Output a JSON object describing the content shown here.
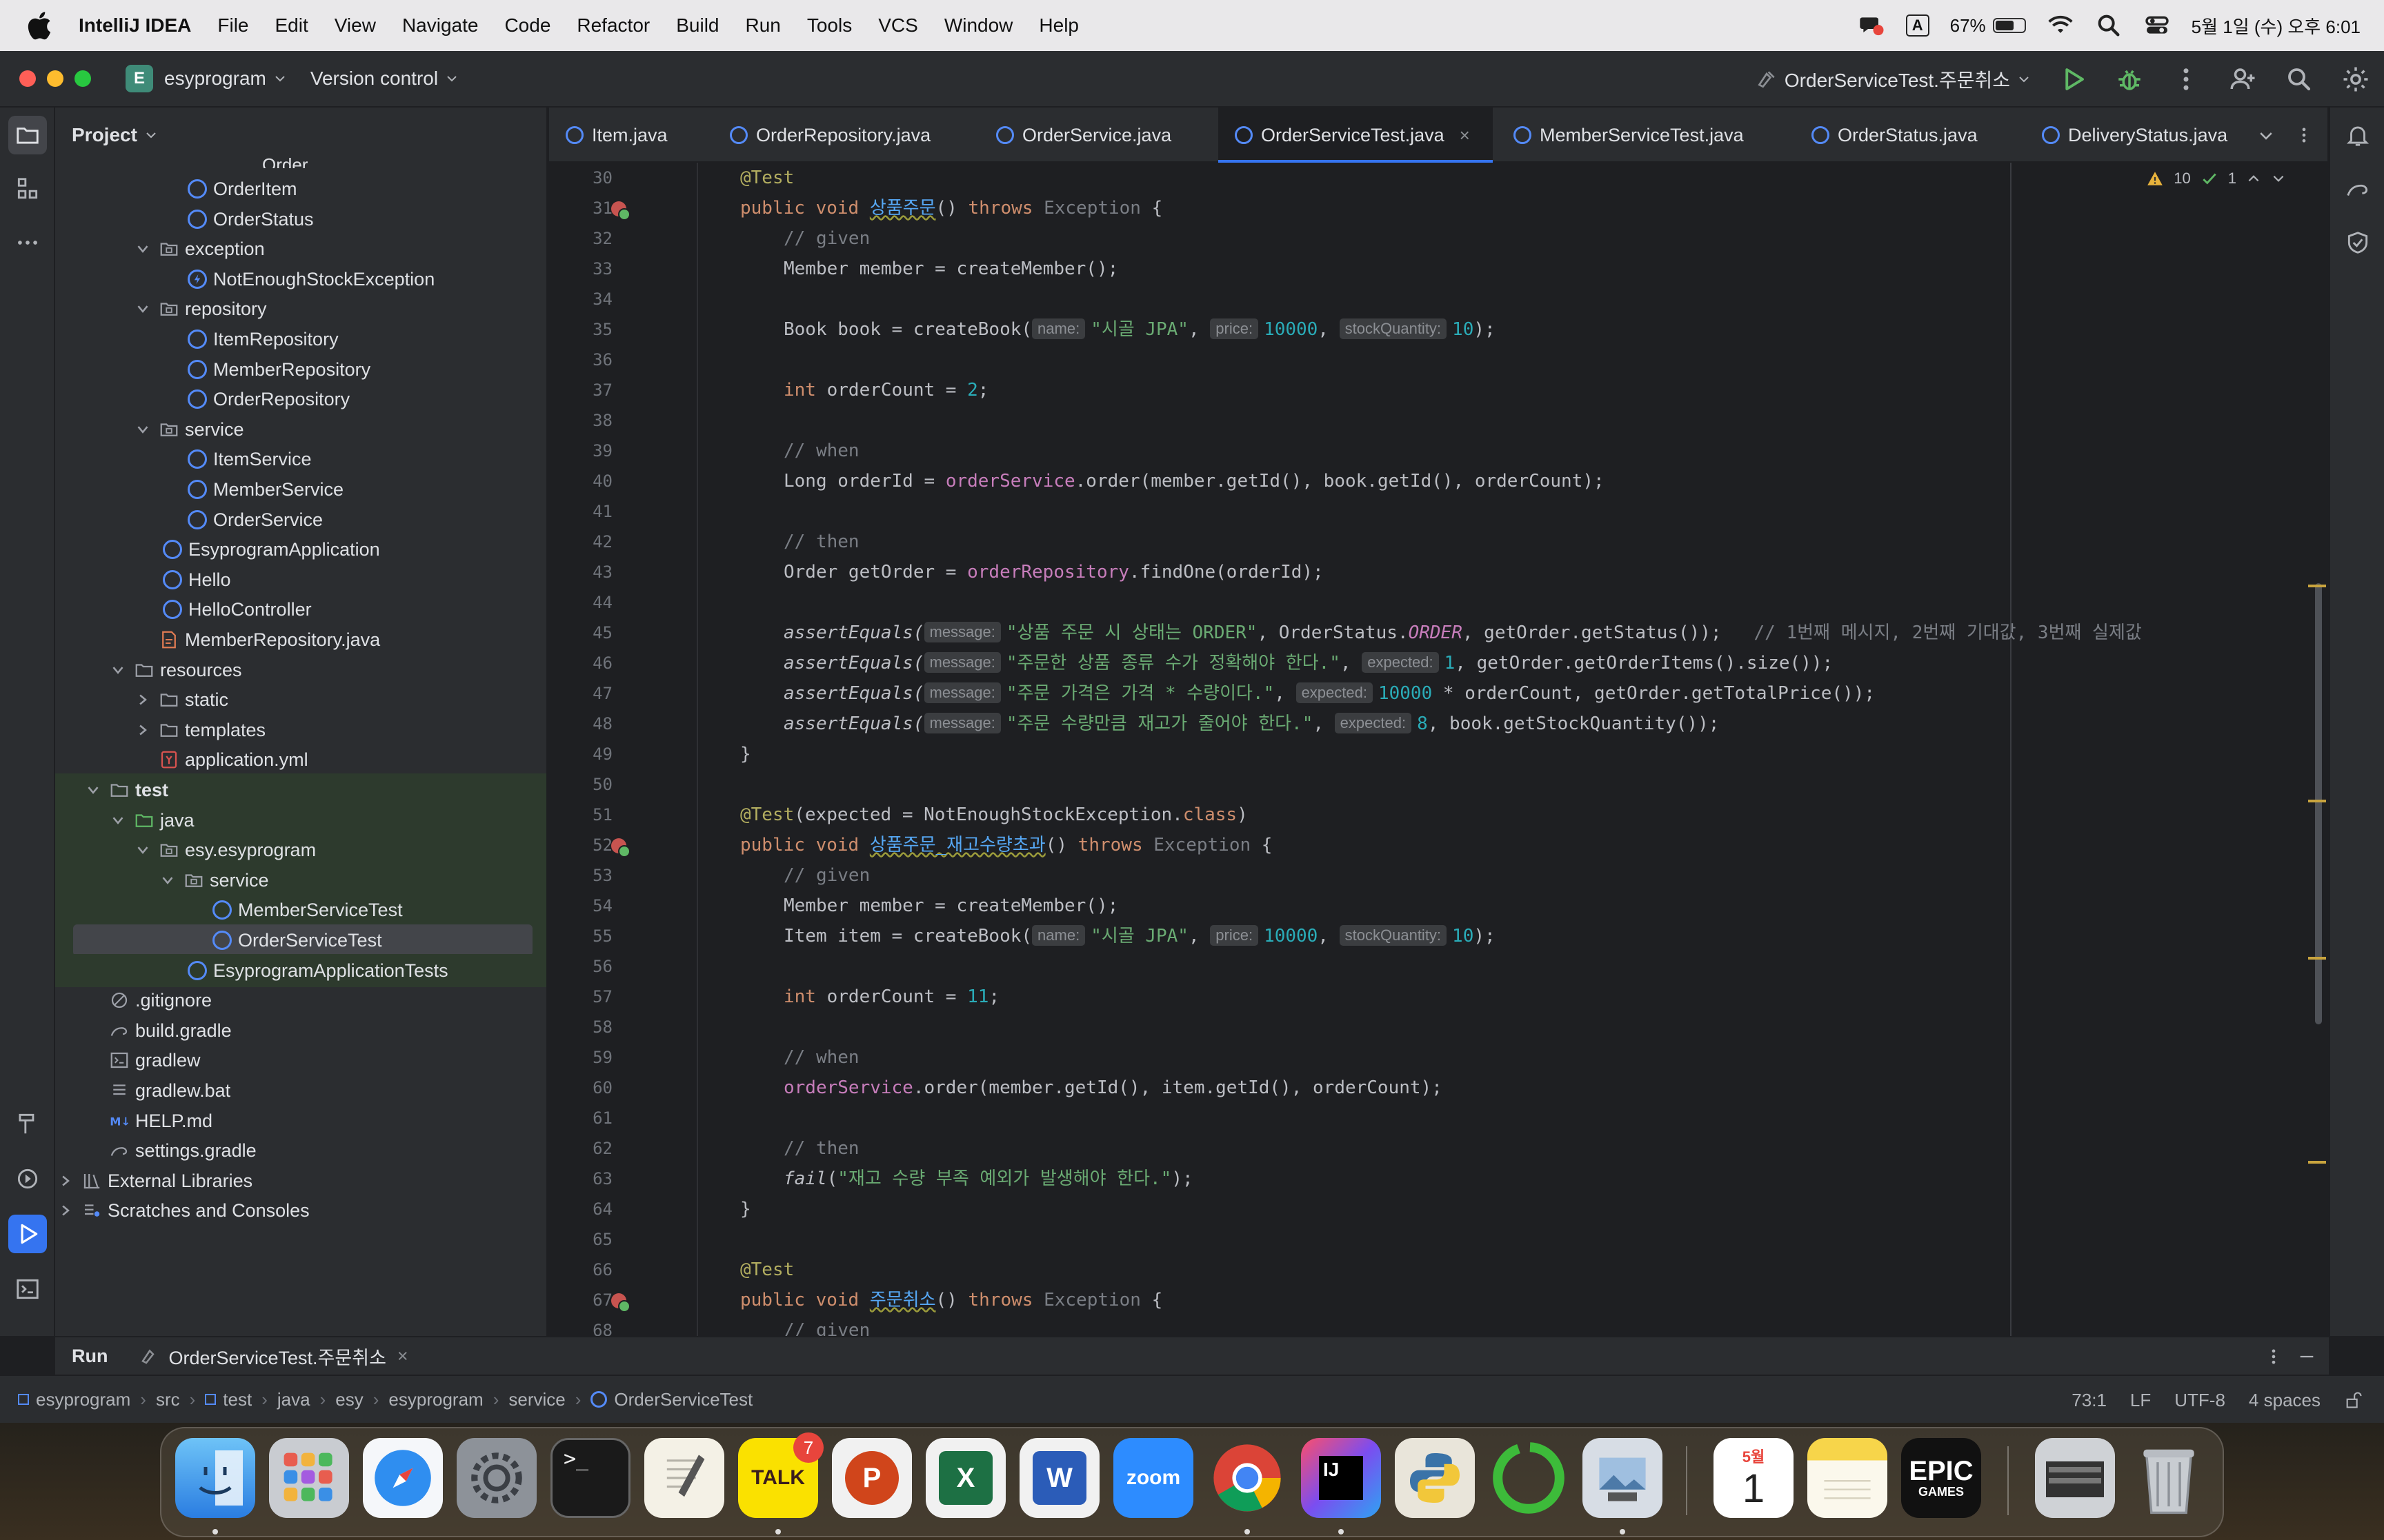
{
  "menubar": {
    "app_name": "IntelliJ IDEA",
    "items": [
      "File",
      "Edit",
      "View",
      "Navigate",
      "Code",
      "Refactor",
      "Build",
      "Run",
      "Tools",
      "VCS",
      "Window",
      "Help"
    ],
    "input_indicator": "A",
    "battery": "67%",
    "battery_level": 0.67,
    "datetime": "5월 1일 (수) 오후 6:01"
  },
  "titlebar": {
    "project_badge": "E",
    "project_name": "esyprogram",
    "vcs_label": "Version control",
    "run_config": "OrderServiceTest.주문취소"
  },
  "project_panel": {
    "title": "Project",
    "partial_top_item": "Order",
    "tree": [
      {
        "label": "OrderItem",
        "type": "class",
        "depth": 3
      },
      {
        "label": "OrderStatus",
        "type": "class",
        "depth": 3
      },
      {
        "label": "exception",
        "type": "package",
        "depth": 2,
        "expanded": true
      },
      {
        "label": "NotEnoughStockException",
        "type": "exception",
        "depth": 3
      },
      {
        "label": "repository",
        "type": "package",
        "depth": 2,
        "expanded": true
      },
      {
        "label": "ItemRepository",
        "type": "class",
        "depth": 3
      },
      {
        "label": "MemberRepository",
        "type": "class",
        "depth": 3
      },
      {
        "label": "OrderRepository",
        "type": "class",
        "depth": 3
      },
      {
        "label": "service",
        "type": "package",
        "depth": 2,
        "expanded": true
      },
      {
        "label": "ItemService",
        "type": "class",
        "depth": 3
      },
      {
        "label": "MemberService",
        "type": "class",
        "depth": 3
      },
      {
        "label": "OrderService",
        "type": "class",
        "depth": 3
      },
      {
        "label": "EsyprogramApplication",
        "type": "class",
        "depth": 2
      },
      {
        "label": "Hello",
        "type": "class",
        "depth": 2
      },
      {
        "label": "HelloController",
        "type": "class",
        "depth": 2
      },
      {
        "label": "MemberRepository.java",
        "type": "java-file",
        "depth": 2
      },
      {
        "label": "resources",
        "type": "folder",
        "depth": 1,
        "expanded": true
      },
      {
        "label": "static",
        "type": "folder",
        "depth": 2,
        "expanded": false
      },
      {
        "label": "templates",
        "type": "folder",
        "depth": 2,
        "expanded": false
      },
      {
        "label": "application.yml",
        "type": "yml",
        "depth": 2
      },
      {
        "label": "test",
        "type": "folder",
        "depth": 0,
        "expanded": true,
        "test": true,
        "bold": true
      },
      {
        "label": "java",
        "type": "test-folder",
        "depth": 1,
        "expanded": true,
        "test": true
      },
      {
        "label": "esy.esyprogram",
        "type": "package",
        "depth": 2,
        "expanded": true,
        "test": true
      },
      {
        "label": "service",
        "type": "package",
        "depth": 3,
        "expanded": true,
        "test": true
      },
      {
        "label": "MemberServiceTest",
        "type": "class",
        "depth": 4,
        "test": true
      },
      {
        "label": "OrderServiceTest",
        "type": "class",
        "depth": 4,
        "test": true,
        "selected": true
      },
      {
        "label": "EsyprogramApplicationTests",
        "type": "class",
        "depth": 3,
        "test": true
      },
      {
        "label": ".gitignore",
        "type": "ignore",
        "depth": 0
      },
      {
        "label": "build.gradle",
        "type": "gradle",
        "depth": 0
      },
      {
        "label": "gradlew",
        "type": "script",
        "depth": 0
      },
      {
        "label": "gradlew.bat",
        "type": "text",
        "depth": 0
      },
      {
        "label": "HELP.md",
        "type": "markdown",
        "depth": 0
      },
      {
        "label": "settings.gradle",
        "type": "gradle",
        "depth": 0
      },
      {
        "label": "External Libraries",
        "type": "libraries",
        "depth": -1,
        "expanded": false
      },
      {
        "label": "Scratches and Consoles",
        "type": "scratches",
        "depth": -1,
        "expanded": false
      }
    ]
  },
  "tabs": [
    {
      "label": "Item.java",
      "active": false
    },
    {
      "label": "OrderRepository.java",
      "active": false
    },
    {
      "label": "OrderService.java",
      "active": false
    },
    {
      "label": "OrderServiceTest.java",
      "active": true,
      "close": "×"
    },
    {
      "label": "MemberServiceTest.java",
      "active": false
    },
    {
      "label": "OrderStatus.java",
      "active": false
    },
    {
      "label": "DeliveryStatus.java",
      "active": false
    }
  ],
  "inspections": {
    "warnings": "10",
    "ok": "1"
  },
  "hints": {
    "name": "name:",
    "price": "price:",
    "stock": "stockQuantity:",
    "message": "message:",
    "expected": "expected:"
  },
  "code": {
    "l30": "@Test",
    "l31_a": "public void ",
    "l31_fn": "상품주문",
    "l31_b": "() ",
    "l31_throws": "throws",
    "l31_exc": " Exception",
    "l31_c": " {",
    "l32": "// given",
    "l33": "Member member = createMember();",
    "l35_a": "Book book = createBook(",
    "l35_s": "\"시골 JPA\"",
    "l35_n1": "10000",
    "l35_n2": "10",
    "l35_end": ");",
    "l37_kw": "int",
    "l37_a": " orderCount = ",
    "l37_n": "2",
    "l37_end": ";",
    "l39": "// when",
    "l40_a": "Long orderId = ",
    "l40_f": "orderService",
    "l40_b": ".order(member.getId(), book.getId(), orderCount);",
    "l42": "// then",
    "l43_a": "Order getOrder = ",
    "l43_f": "orderRepository",
    "l43_b": ".findOne(orderId);",
    "l45_fn": "assertEquals(",
    "l45_s": "\"상품 주문 시 상태는 ORDER\"",
    "l45_a": ", OrderStatus.",
    "l45_enum": "ORDER",
    "l45_b": ", getOrder.getStatus());",
    "l45_cm": "   // 1번째 메시지, 2번째 기대값, 3번째 실제값",
    "l46_s": "\"주문한 상품 종류 수가 정확해야 한다.\"",
    "l46_n": "1",
    "l46_b": ", getOrder.getOrderItems().size());",
    "l47_s": "\"주문 가격은 가격 * 수량이다.\"",
    "l47_n": "10000",
    "l47_b": " * orderCount, getOrder.getTotalPrice());",
    "l48_s": "\"주문 수량만큼 재고가 줄어야 한다.\"",
    "l48_n": "8",
    "l48_b": ", book.getStockQuantity());",
    "l49": "}",
    "l51_an": "@Test",
    "l51_a": "(expected = NotEnoughStockException.",
    "l51_kw": "class",
    "l51_b": ")",
    "l52_fn": "상품주문_재고수량초과",
    "l53": "// given",
    "l54": "Member member = createMember();",
    "l55_a": "Item item = createBook(",
    "l57_n": "11",
    "l59": "// when",
    "l60_f": "orderService",
    "l60_b": ".order(member.getId(), item.getId(), orderCount);",
    "l62": "// then",
    "l63_fn": "fail",
    "l63_a": "(",
    "l63_s": "\"재고 수량 부족 예외가 발생해야 한다.\"",
    "l63_b": ");",
    "l64": "}",
    "l66": "@Test",
    "l67_fn": "주문취소",
    "l68": "// given"
  },
  "runbar": {
    "title": "Run",
    "config": "OrderServiceTest.주문취소",
    "close": "×"
  },
  "statusbar": {
    "breadcrumbs": [
      "esyprogram",
      "src",
      "test",
      "java",
      "esy",
      "esyprogram",
      "service",
      "OrderServiceTest"
    ],
    "position": "73:1",
    "line_sep": "LF",
    "encoding": "UTF-8",
    "indent": "4 spaces"
  },
  "dock": {
    "talk_label": "TALK",
    "talk_badge": "7",
    "zoom_label": "zoom",
    "calendar_month": "5월",
    "calendar_day": "1",
    "epic_line1": "EPIC",
    "epic_line2": "GAMES",
    "ij_label": "IJ",
    "terminal_prompt": ">_",
    "ppt_letter": "P",
    "excel_letter": "X",
    "word_letter": "W"
  }
}
